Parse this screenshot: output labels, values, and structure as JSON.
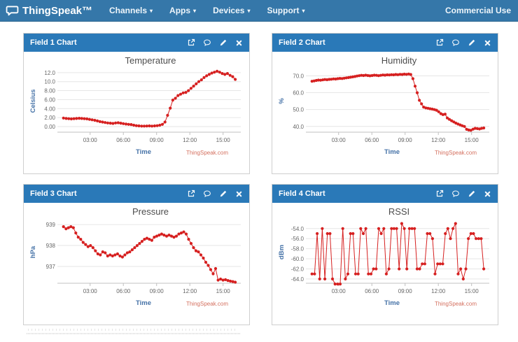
{
  "header": {
    "brand": "ThingSpeak™",
    "nav": [
      {
        "label": "Channels"
      },
      {
        "label": "Apps"
      },
      {
        "label": "Devices"
      },
      {
        "label": "Support"
      }
    ],
    "commercial": "Commercial Use"
  },
  "panels": [
    {
      "title": "Field 1 Chart"
    },
    {
      "title": "Field 2 Chart"
    },
    {
      "title": "Field 3 Chart"
    },
    {
      "title": "Field 4 Chart"
    }
  ],
  "icons": {
    "brand": "speech-bubble-logo-icon",
    "nav_caret": "chevron-down-icon",
    "panel_tools": [
      "external-link-icon",
      "comment-bubble-icon",
      "pencil-icon",
      "close-x-icon"
    ]
  },
  "credits": "ThingSpeak.com",
  "colors": {
    "navbar": "#3577a9",
    "panel_header": "#2a79b8",
    "line": "#d62020",
    "axis_title": "#4572a7",
    "credits": "#d4705f",
    "tick_label": "#666666",
    "grid": "#e6e6e6",
    "chart_title": "#4d4d4d"
  },
  "chart_data": [
    {
      "type": "line",
      "title": "Temperature",
      "ylabel": "Celsius",
      "xlabel": "Time",
      "grid": "horizontal",
      "legend": "none",
      "x_range_hours": [
        0.6,
        16.1
      ],
      "xlim": [
        0.3,
        16.6
      ],
      "ylim": [
        -1.25,
        12.6
      ],
      "ytick_values": [
        0,
        2,
        4,
        6,
        8,
        10,
        12
      ],
      "ytick_labels": [
        "0.00",
        "2.00",
        "4.00",
        "6.00",
        "8.00",
        "10.0",
        "12.0"
      ],
      "xtick_values": [
        3,
        6,
        9,
        12,
        15
      ],
      "xtick_labels": [
        "03:00",
        "06:00",
        "09:00",
        "12:00",
        "15:00"
      ],
      "values": [
        1.9,
        1.8,
        1.75,
        1.7,
        1.75,
        1.8,
        1.85,
        1.8,
        1.75,
        1.7,
        1.6,
        1.5,
        1.4,
        1.25,
        1.1,
        1.0,
        0.9,
        0.8,
        0.75,
        0.7,
        0.8,
        0.85,
        0.75,
        0.65,
        0.55,
        0.5,
        0.45,
        0.3,
        0.2,
        0.15,
        0.1,
        0.1,
        0.12,
        0.15,
        0.1,
        0.15,
        0.2,
        0.3,
        0.5,
        1.0,
        2.5,
        4.1,
        5.9,
        6.3,
        6.9,
        7.2,
        7.5,
        7.6,
        8.0,
        8.5,
        9.0,
        9.5,
        10.0,
        10.4,
        10.9,
        11.3,
        11.6,
        11.9,
        12.1,
        12.3,
        12.1,
        11.8,
        11.6,
        11.8,
        11.4,
        11.1,
        10.5
      ]
    },
    {
      "type": "line",
      "title": "Humidity",
      "ylabel": "%",
      "xlabel": "Time",
      "grid": "horizontal",
      "legend": "none",
      "x_range_hours": [
        0.6,
        16.1
      ],
      "xlim": [
        0.3,
        16.6
      ],
      "ylim": [
        36.6,
        73.5
      ],
      "ytick_values": [
        40,
        50,
        60,
        70
      ],
      "ytick_labels": [
        "40.0",
        "50.0",
        "60.0",
        "70.0"
      ],
      "xtick_values": [
        3,
        6,
        9,
        12,
        15
      ],
      "xtick_labels": [
        "03:00",
        "06:00",
        "09:00",
        "12:00",
        "15:00"
      ],
      "values": [
        66.8,
        67.0,
        67.3,
        67.5,
        67.4,
        67.6,
        67.8,
        67.7,
        67.9,
        68.0,
        68.2,
        68.1,
        68.3,
        68.5,
        68.4,
        68.6,
        68.8,
        69.0,
        69.2,
        69.4,
        69.6,
        69.9,
        70.1,
        70.3,
        70.2,
        70.4,
        70.2,
        70.0,
        70.2,
        70.4,
        70.3,
        70.1,
        70.3,
        70.5,
        70.4,
        70.6,
        70.5,
        70.7,
        70.6,
        70.8,
        70.7,
        70.9,
        70.8,
        71.0,
        70.9,
        71.1,
        70.8,
        68.3,
        63.9,
        60.0,
        55.5,
        53.4,
        51.5,
        51.0,
        50.8,
        50.5,
        50.3,
        50.0,
        49.6,
        48.7,
        47.6,
        47.0,
        47.3,
        45.0,
        44.2,
        43.4,
        42.7,
        42.0,
        41.4,
        40.9,
        40.4,
        40.0,
        38.3,
        37.9,
        37.7,
        38.4,
        38.9,
        38.7,
        38.5,
        38.9,
        39.1
      ]
    },
    {
      "type": "line",
      "title": "Pressure",
      "ylabel": "hPa",
      "xlabel": "Time",
      "grid": "horizontal",
      "legend": "none",
      "x_range_hours": [
        0.6,
        16.1
      ],
      "xlim": [
        0.3,
        16.6
      ],
      "ylim": [
        936.2,
        939.17
      ],
      "ytick_values": [
        937,
        938,
        939
      ],
      "ytick_labels": [
        "937",
        "938",
        "939"
      ],
      "xtick_values": [
        3,
        6,
        9,
        12,
        15
      ],
      "xtick_labels": [
        "03:00",
        "06:00",
        "09:00",
        "12:00",
        "15:00"
      ],
      "values": [
        938.9,
        938.8,
        938.85,
        938.9,
        938.85,
        938.6,
        938.4,
        938.3,
        938.15,
        938.05,
        937.95,
        938.0,
        937.9,
        937.75,
        937.6,
        937.55,
        937.7,
        937.65,
        937.5,
        937.55,
        937.5,
        937.55,
        937.6,
        937.5,
        937.45,
        937.55,
        937.65,
        937.7,
        937.8,
        937.9,
        938.0,
        938.1,
        938.2,
        938.3,
        938.35,
        938.3,
        938.25,
        938.4,
        938.45,
        938.5,
        938.55,
        938.5,
        938.45,
        938.5,
        938.45,
        938.4,
        938.45,
        938.55,
        938.6,
        938.65,
        938.55,
        938.3,
        938.1,
        937.9,
        937.75,
        937.7,
        937.55,
        937.4,
        937.2,
        937.05,
        936.85,
        936.65,
        936.9,
        936.35,
        936.4,
        936.35,
        936.37,
        936.33,
        936.3,
        936.28,
        936.25
      ]
    },
    {
      "type": "line",
      "title": "RSSI",
      "ylabel": "dBm",
      "xlabel": "Time",
      "grid": "horizontal",
      "legend": "none",
      "x_range_hours": [
        0.6,
        16.1
      ],
      "xlim": [
        0.3,
        16.6
      ],
      "ylim": [
        -64.85,
        -52.5
      ],
      "ytick_values": [
        -54,
        -56,
        -58,
        -60,
        -62,
        -64
      ],
      "ytick_labels": [
        "-54.0",
        "-56.0",
        "-58.0",
        "-60.0",
        "-62.0",
        "-64.0"
      ],
      "xtick_values": [
        3,
        6,
        9,
        12,
        15
      ],
      "xtick_labels": [
        "03:00",
        "06:00",
        "09:00",
        "12:00",
        "15:00"
      ],
      "values": [
        -63,
        -63,
        -55,
        -64,
        -54,
        -64,
        -55,
        -55,
        -64,
        -65,
        -65,
        -65,
        -54,
        -64,
        -63,
        -55,
        -55,
        -63,
        -63,
        -54,
        -55,
        -54,
        -63,
        -63,
        -62,
        -62,
        -54,
        -55,
        -54,
        -63,
        -62,
        -54,
        -54,
        -54,
        -62,
        -53,
        -54,
        -62,
        -54,
        -54,
        -54,
        -62,
        -62,
        -61,
        -61,
        -55,
        -55,
        -56,
        -63,
        -61,
        -61,
        -61,
        -55,
        -54,
        -56,
        -54,
        -53,
        -63,
        -62,
        -64,
        -62,
        -56,
        -55,
        -55,
        -56,
        -56,
        -56,
        -62
      ]
    }
  ]
}
